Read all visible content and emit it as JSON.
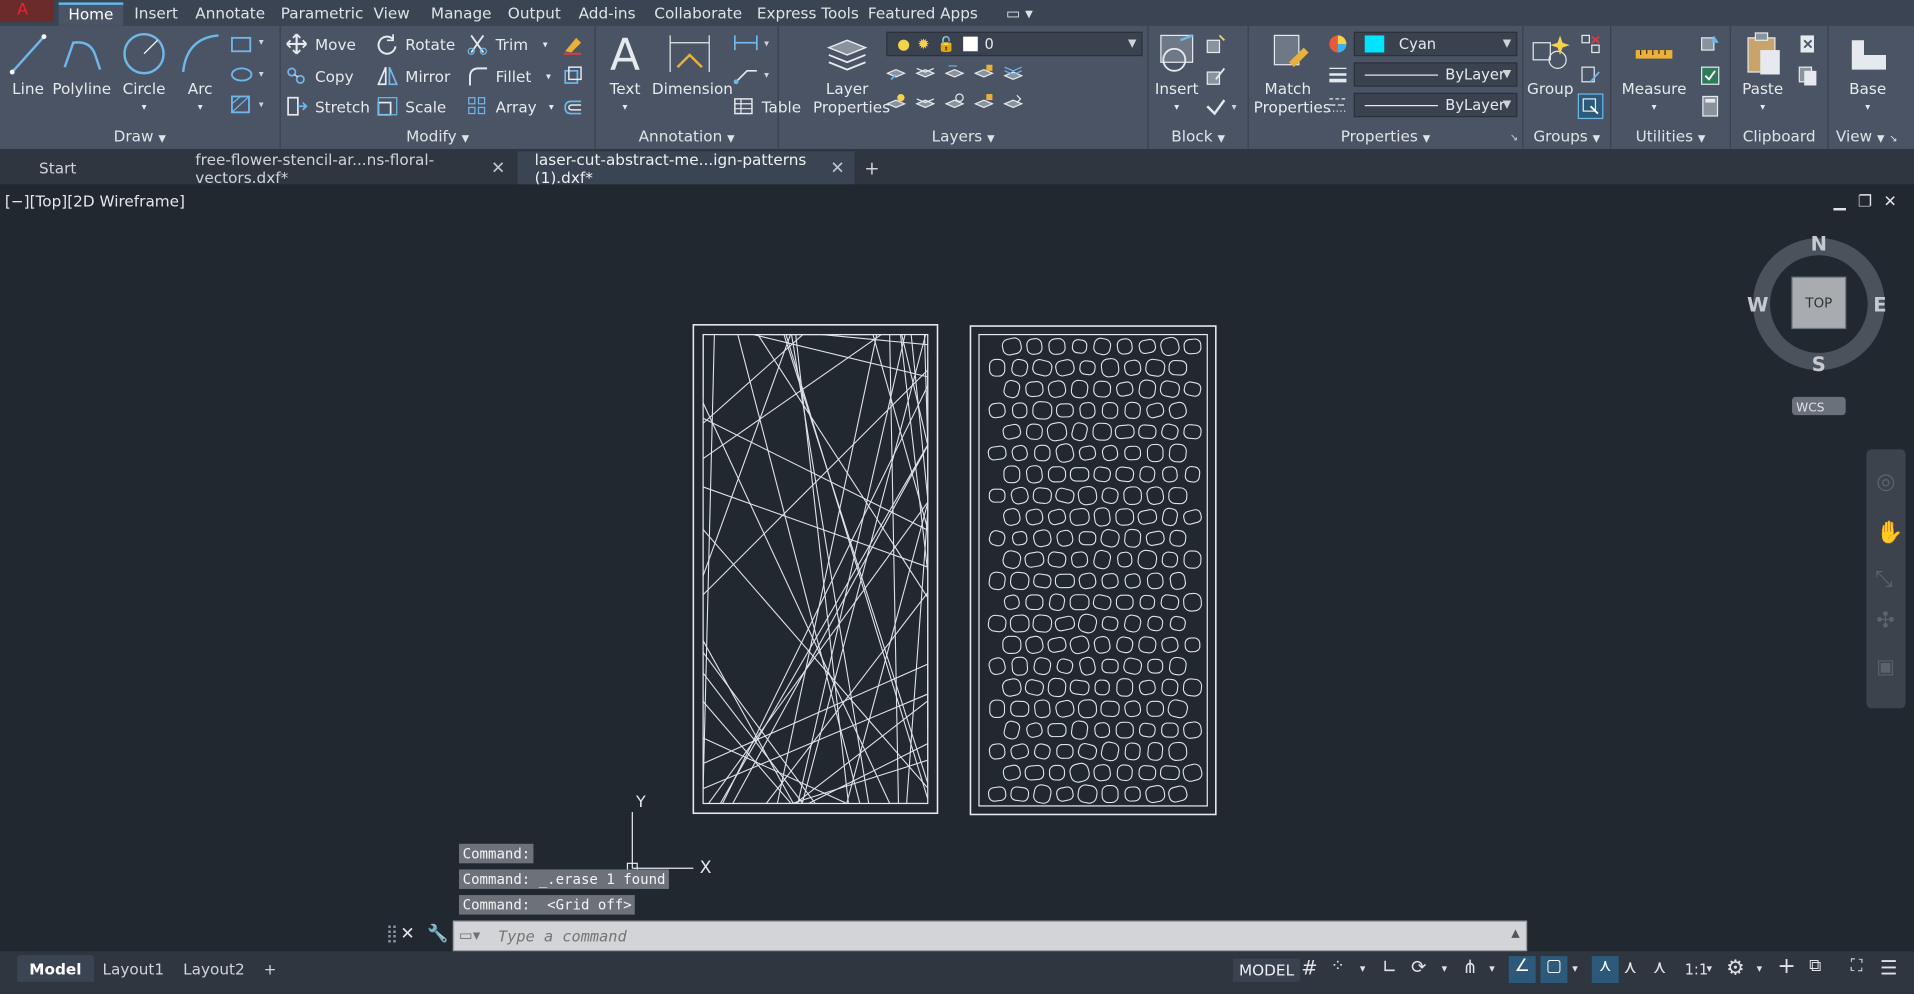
{
  "menu": {
    "tabs": [
      "Home",
      "Insert",
      "Annotate",
      "Parametric",
      "View",
      "Manage",
      "Output",
      "Add-ins",
      "Collaborate",
      "Express Tools",
      "Featured Apps"
    ],
    "active": "Home"
  },
  "ribbon": {
    "draw": {
      "title": "Draw",
      "line": "Line",
      "polyline": "Polyline",
      "circle": "Circle",
      "arc": "Arc"
    },
    "modify": {
      "title": "Modify",
      "move": "Move",
      "rotate": "Rotate",
      "trim": "Trim",
      "copy": "Copy",
      "mirror": "Mirror",
      "fillet": "Fillet",
      "stretch": "Stretch",
      "scale": "Scale",
      "array": "Array"
    },
    "annotation": {
      "title": "Annotation",
      "text": "Text",
      "dimension": "Dimension",
      "table": "Table"
    },
    "layers": {
      "title": "Layers",
      "layer_properties_1": "Layer",
      "layer_properties_2": "Properties",
      "current_layer": "0"
    },
    "block": {
      "title": "Block",
      "insert": "Insert"
    },
    "properties": {
      "title": "Properties",
      "match_1": "Match",
      "match_2": "Properties",
      "color": "Cyan",
      "color_hex": "#00e5ff",
      "linetype": "ByLayer",
      "lineweight": "ByLayer"
    },
    "groups": {
      "title": "Groups",
      "group": "Group"
    },
    "utilities": {
      "title": "Utilities",
      "measure": "Measure"
    },
    "clipboard": {
      "title": "Clipboard",
      "paste": "Paste"
    },
    "view": {
      "title": "View",
      "base": "Base"
    }
  },
  "file_tabs": {
    "start": "Start",
    "file1": "free-flower-stencil-ar...ns-floral-vectors.dxf*",
    "file2": "laser-cut-abstract-me...ign-patterns (1).dxf*"
  },
  "viewport": {
    "label": "[−][Top][2D Wireframe]",
    "viewcube": {
      "n": "N",
      "s": "S",
      "e": "E",
      "w": "W",
      "face": "TOP",
      "wcs": "WCS"
    },
    "ucs_x": "X",
    "ucs_y": "Y"
  },
  "command": {
    "history": [
      "Command:",
      "Command: _.erase 1 found",
      "Command:  <Grid off>"
    ],
    "placeholder": "Type a command"
  },
  "layout_tabs": [
    "Model",
    "Layout1",
    "Layout2"
  ],
  "status": {
    "model": "MODEL",
    "scale": "1:1"
  }
}
